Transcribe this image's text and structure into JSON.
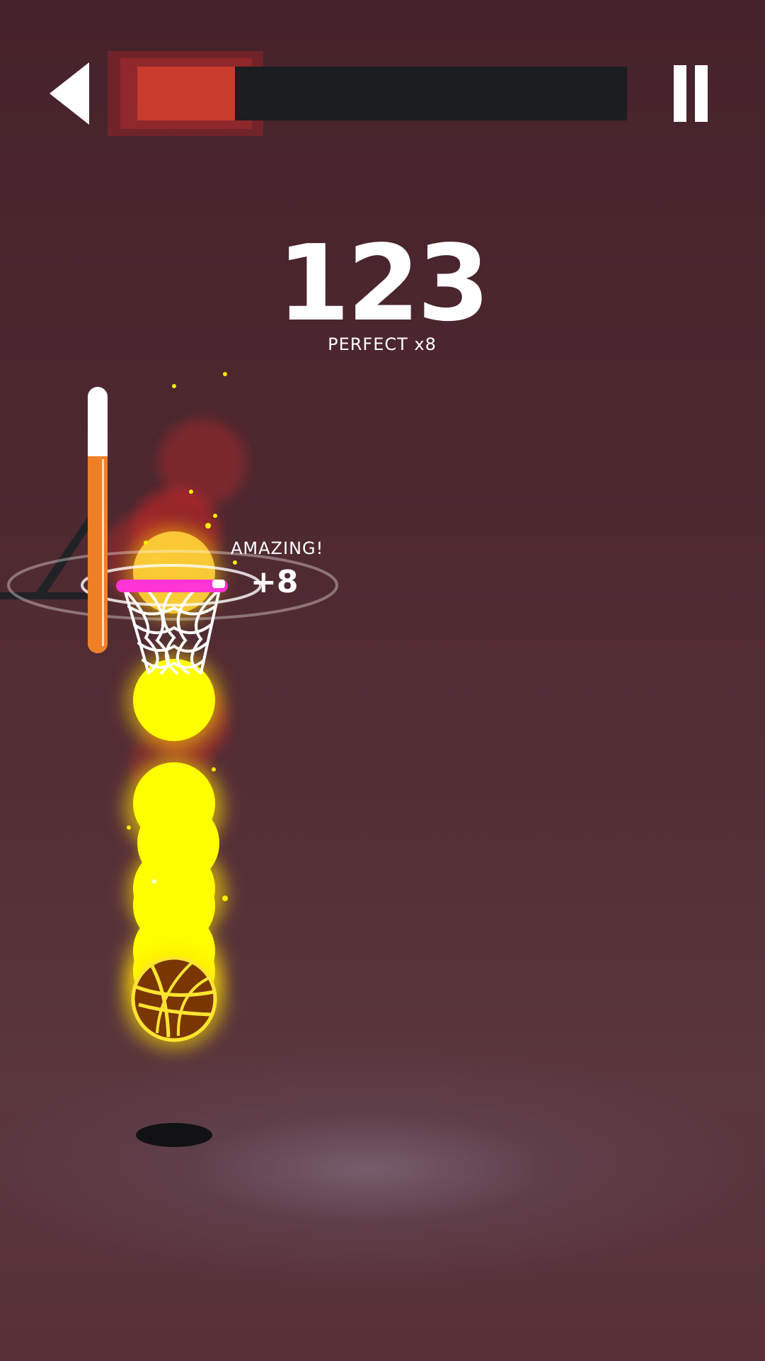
{
  "hud": {
    "score": "123",
    "combo_label": "PERFECT x8",
    "level_progress": 0.2,
    "shot_power": 0.74
  },
  "feedback": {
    "text": "AMAZING!",
    "points": "+8"
  },
  "icons": {
    "back": "back-arrow-icon",
    "pause": "pause-icon"
  },
  "colors": {
    "background": "#4a2328",
    "progress_fill": "#c93b2d",
    "progress_track": "#1b1d21",
    "power_fill": "#f08026",
    "rim": "#ff35d5",
    "ball_trail": "#ffff00",
    "ball": "#7a3600",
    "ball_lines": "#ffe530"
  }
}
